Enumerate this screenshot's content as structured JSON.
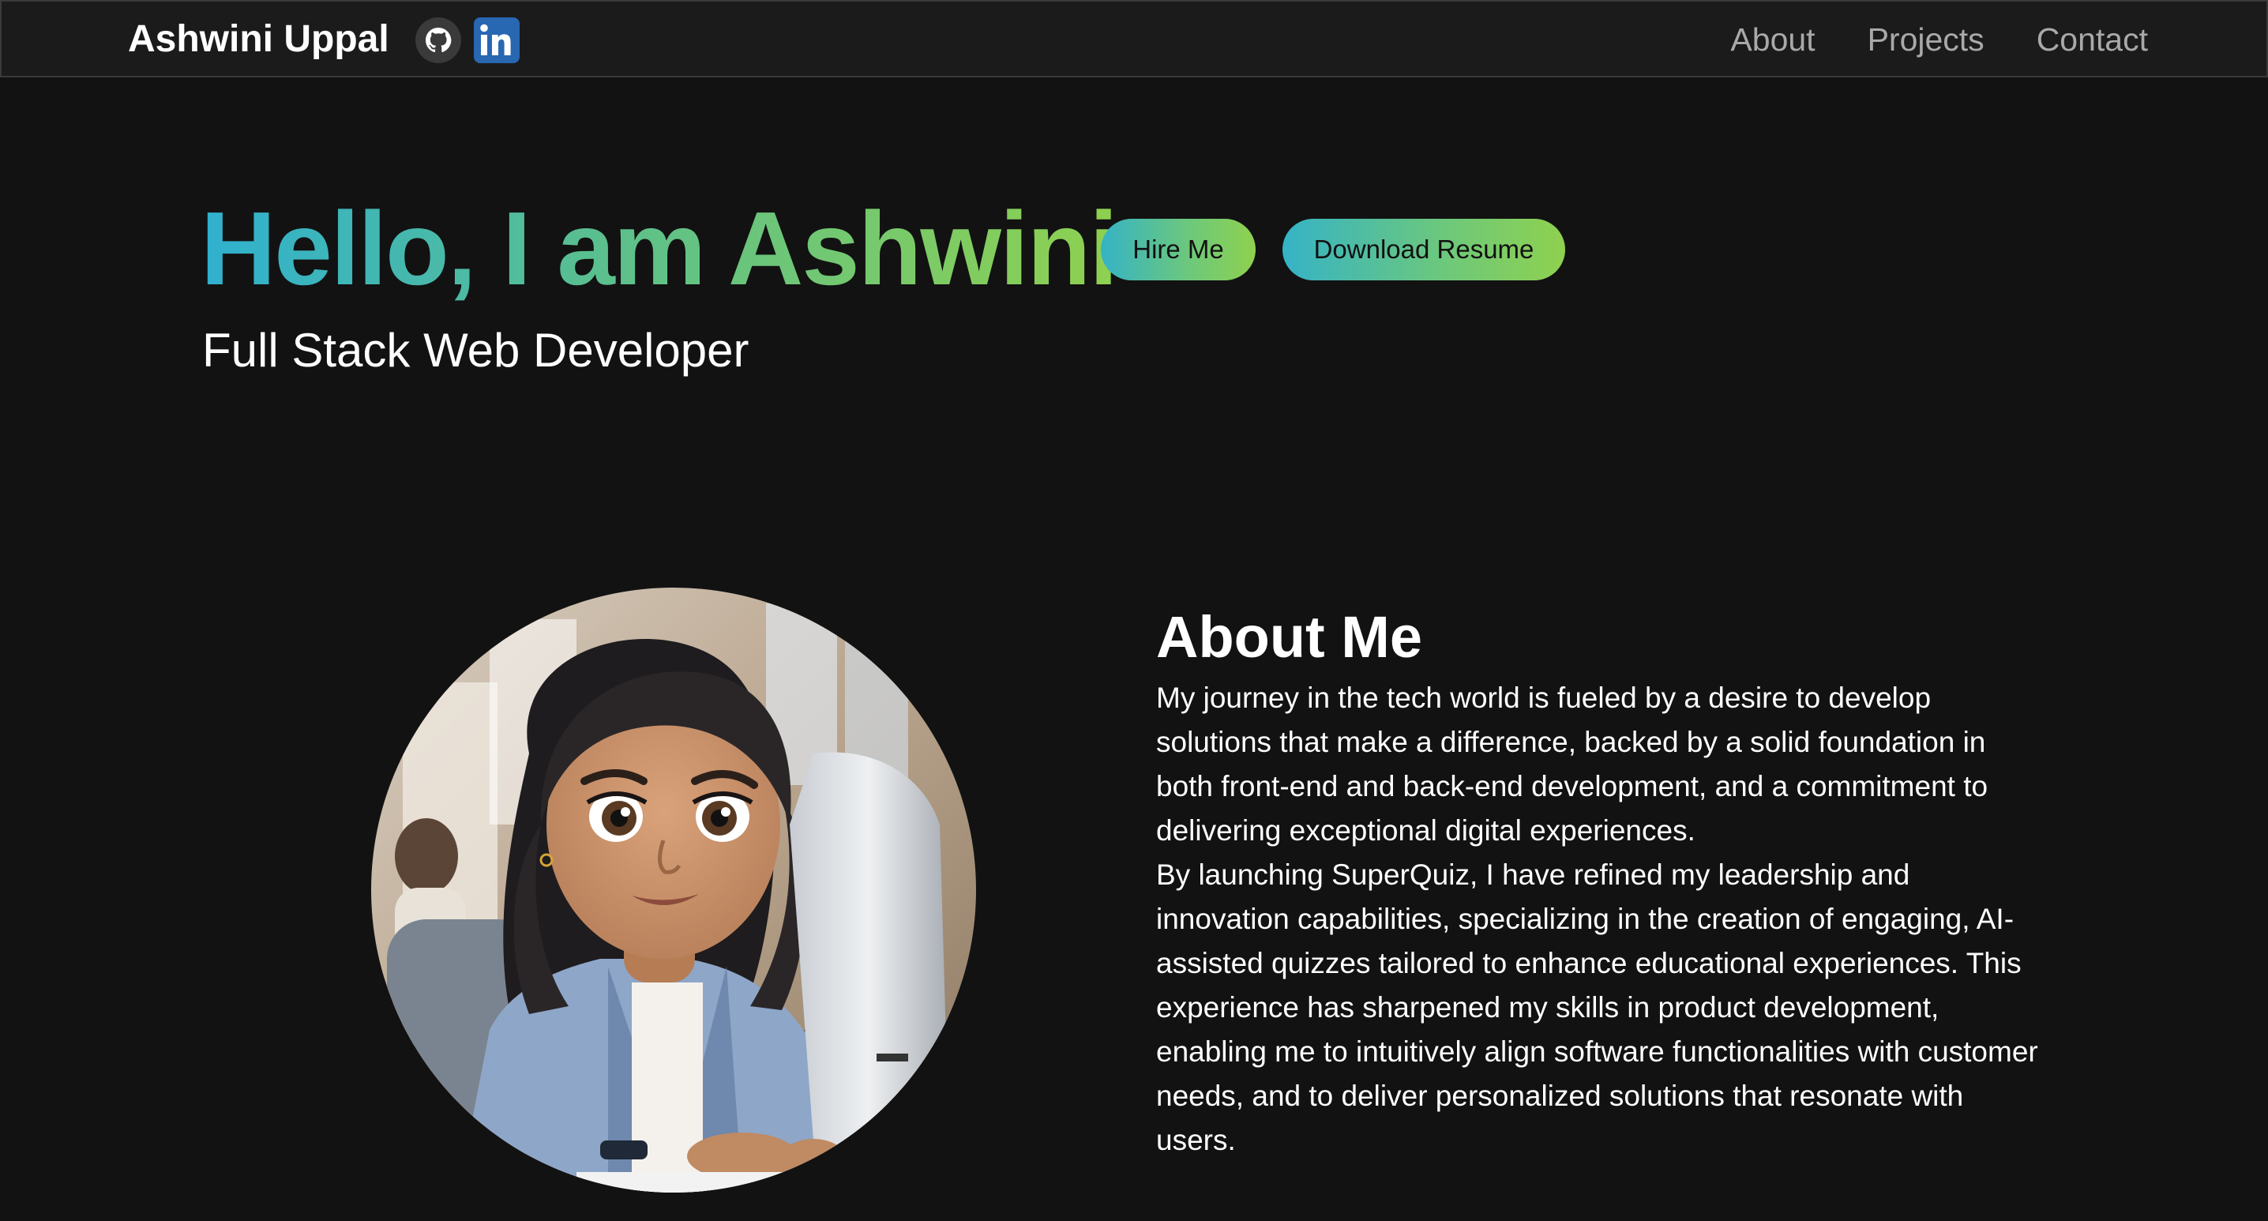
{
  "navbar": {
    "brand": "Ashwini Uppal",
    "links": [
      {
        "label": "About"
      },
      {
        "label": "Projects"
      },
      {
        "label": "Contact"
      }
    ],
    "social": [
      {
        "icon": "github-icon"
      },
      {
        "icon": "linkedin-icon",
        "glyph": "in"
      }
    ]
  },
  "hero": {
    "title": "Hello, I am Ashwini",
    "subtitle": "Full Stack Web Developer",
    "hire_label": "Hire Me",
    "resume_label": "Download Resume"
  },
  "about": {
    "heading": "About Me",
    "paragraphs": [
      "My journey in the tech world is fueled by a desire to develop solutions that make a difference, backed by a solid foundation in both front-end and back-end development, and a commitment to delivering exceptional digital experiences.",
      "By launching SuperQuiz, I have refined my leadership and innovation capabilities, specializing in the creation of engaging, AI-assisted quizzes tailored to enhance educational experiences. This experience has sharpened my skills in product development, enabling me to intuitively align software functionalities with customer needs, and to deliver personalized solutions that resonate with users."
    ]
  },
  "colors": {
    "background": "#121212",
    "navbar": "#1b1b1b",
    "gradient_start": "#2fb0cf",
    "gradient_end": "#8fd14f",
    "linkedin": "#2867b2",
    "nav_link": "#a9a9a9"
  }
}
